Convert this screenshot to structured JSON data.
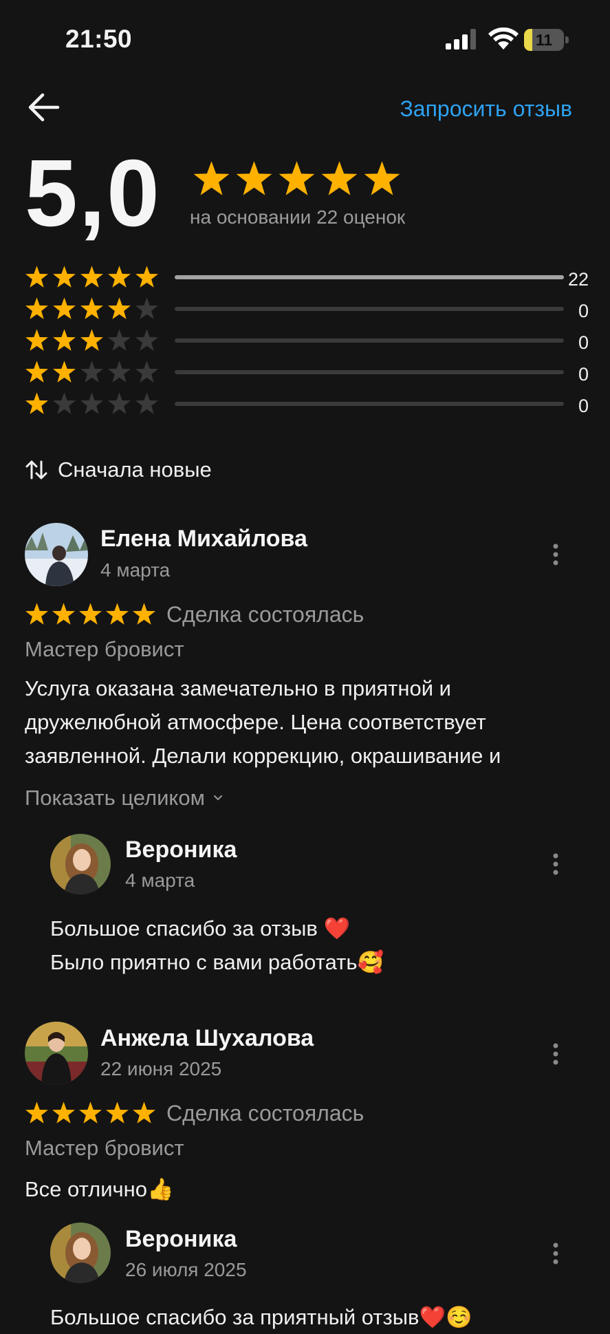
{
  "status_bar": {
    "time": "21:50",
    "battery": "11"
  },
  "header": {
    "back_icon": "arrow-left-icon",
    "request_label": "Запросить отзыв"
  },
  "summary": {
    "rating": "5,0",
    "stars": 5,
    "based_on": "на основании 22 оценок",
    "distribution": [
      {
        "stars": 5,
        "count": "22",
        "fraction": 1.0
      },
      {
        "stars": 4,
        "count": "0",
        "fraction": 0
      },
      {
        "stars": 3,
        "count": "0",
        "fraction": 0
      },
      {
        "stars": 2,
        "count": "0",
        "fraction": 0
      },
      {
        "stars": 1,
        "count": "0",
        "fraction": 0
      }
    ]
  },
  "sort": {
    "icon": "sort-arrows-icon",
    "label": "Сначала новые"
  },
  "colors": {
    "star": "#ffb100",
    "star_empty": "#3a3a3a",
    "accent": "#2ea2f2",
    "background": "#141414"
  },
  "reviews": [
    {
      "name": "Елена Михайлова",
      "date": "4 марта",
      "stars": 5,
      "deal": "Сделка состоялась",
      "category": "Мастер бровист",
      "text_lines": [
        "Услуга оказана замечательно в приятной и",
        "дружелюбной атмосфере. Цена соответствует",
        "заявленной. Делали коррекцию, окрашивание и"
      ],
      "show_more": "Показать целиком",
      "reply": {
        "name": "Вероника",
        "date": "4 марта",
        "text_lines": [
          "Большое спасибо за отзыв ❤️",
          "Было приятно с вами работать🥰"
        ]
      }
    },
    {
      "name": "Анжела Шухалова",
      "date": "22 июня 2025",
      "stars": 5,
      "deal": "Сделка состоялась",
      "category": "Мастер бровист",
      "text_lines": [
        "Все отлично👍"
      ],
      "reply": {
        "name": "Вероника",
        "date": "26 июля 2025",
        "text_lines": [
          "Большое спасибо за приятный отзыв❤️☺️"
        ]
      }
    }
  ]
}
